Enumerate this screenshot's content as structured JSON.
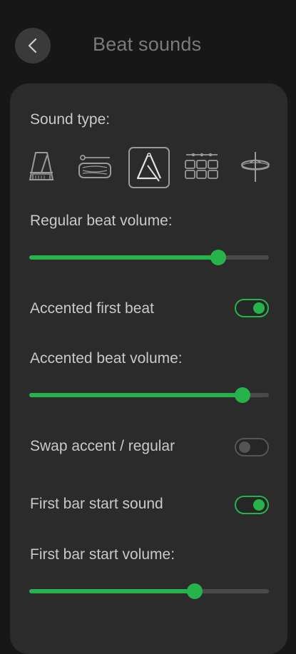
{
  "header": {
    "back_icon": "chevron-left-icon",
    "title": "Beat sounds"
  },
  "sound_type": {
    "label": "Sound type:",
    "options": [
      {
        "icon": "metronome-icon",
        "selected": false
      },
      {
        "icon": "woodblock-icon",
        "selected": false
      },
      {
        "icon": "triangle-icon",
        "selected": true
      },
      {
        "icon": "drum-pads-icon",
        "selected": false
      },
      {
        "icon": "cymbal-icon",
        "selected": false
      }
    ]
  },
  "regular_volume": {
    "label": "Regular beat volume:",
    "value": 0.79
  },
  "accented_first_beat": {
    "label": "Accented first beat",
    "on": true
  },
  "accented_volume": {
    "label": "Accented beat volume:",
    "value": 0.89
  },
  "swap_accent": {
    "label": "Swap accent / regular",
    "on": false
  },
  "first_bar_sound": {
    "label": "First bar start sound",
    "on": true
  },
  "first_bar_volume": {
    "label": "First bar start volume:",
    "value": 0.69
  },
  "colors": {
    "accent": "#27b34b",
    "background": "#171717",
    "card": "#2b2b2b"
  }
}
